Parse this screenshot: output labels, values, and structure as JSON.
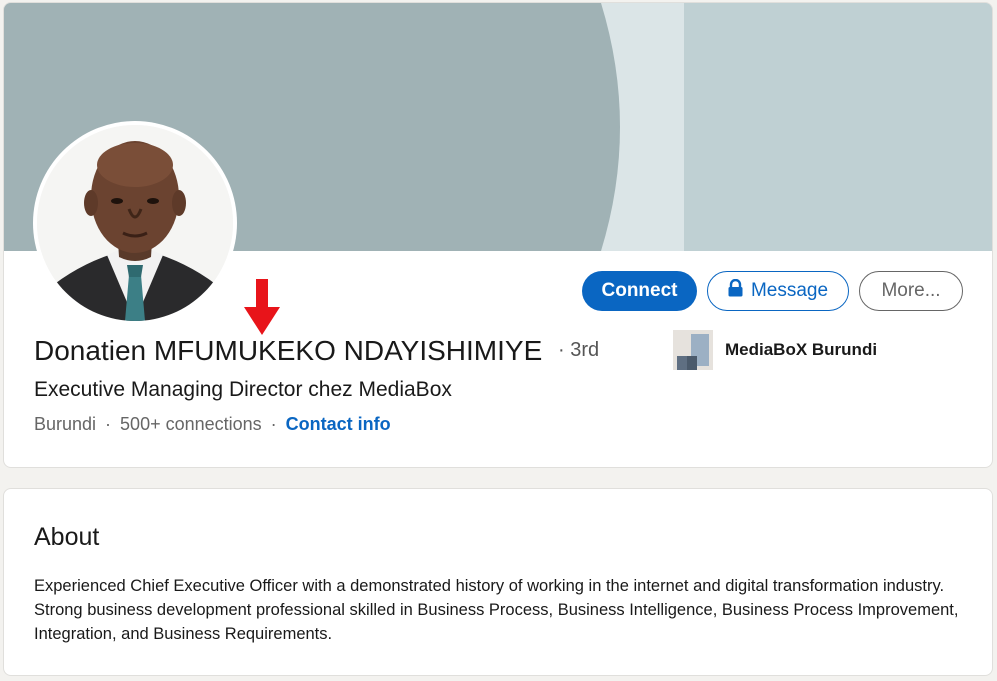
{
  "profile": {
    "name": "Donatien MFUMUKEKO NDAYISHIMIYE",
    "degree": "· 3rd",
    "headline": "Executive Managing Director chez MediaBox",
    "location": "Burundi",
    "connections": "500+ connections",
    "contact_info": "Contact info",
    "separator": "·"
  },
  "actions": {
    "connect": "Connect",
    "message": "Message",
    "more": "More..."
  },
  "company": {
    "name": "MediaBoX Burundi"
  },
  "about": {
    "title": "About",
    "text": "Experienced Chief Executive Officer with a demonstrated history of working in the internet and digital transformation industry. Strong business development professional skilled in Business Process, Business Intelligence, Business Process Improvement, Integration, and Business Requirements."
  },
  "colors": {
    "primary": "#0a66c2",
    "banner_dark": "#a0b2b5",
    "banner_light": "#bfd0d3",
    "banner_stripe": "#dbe5e7",
    "arrow": "#e8141a"
  },
  "icons": {
    "lock": "lock-icon",
    "arrow": "down-arrow-icon"
  }
}
